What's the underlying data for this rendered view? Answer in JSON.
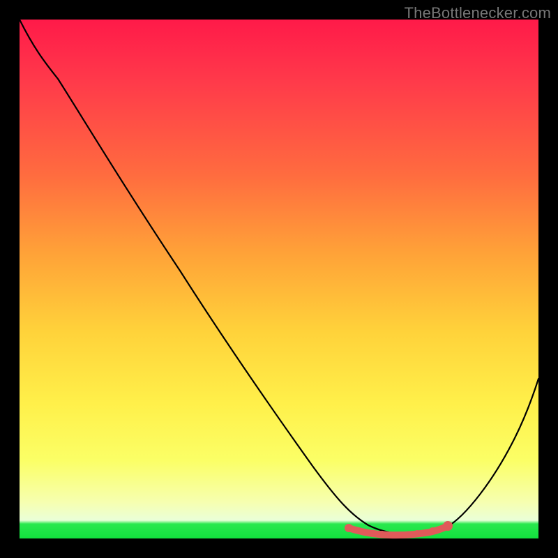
{
  "watermark": "TheBottlenecker.com",
  "colors": {
    "background": "#000000",
    "gradient_top": "#ff1a49",
    "gradient_mid1": "#ff6c3f",
    "gradient_mid2": "#ffd23a",
    "gradient_mid3": "#fbff66",
    "gradient_bottom": "#12e03e",
    "curve": "#000000",
    "markers": "#e05a5a"
  },
  "chart_data": {
    "type": "line",
    "title": "",
    "xlabel": "",
    "ylabel": "",
    "xlim": [
      0,
      100
    ],
    "ylim": [
      0,
      100
    ],
    "x": [
      0,
      3,
      8,
      15,
      25,
      35,
      45,
      55,
      62,
      66,
      70,
      74,
      78,
      82,
      86,
      90,
      95,
      100
    ],
    "values": [
      100,
      95,
      90,
      82,
      68,
      54,
      40,
      25,
      14,
      7,
      3,
      1,
      1,
      2,
      6,
      12,
      22,
      34
    ],
    "annotations": {
      "optimum_band_x": [
        62,
        82
      ],
      "optimum_band_y": 1,
      "marker_points_x": [
        62,
        65,
        68,
        71,
        74,
        77,
        80,
        82
      ]
    },
    "grid": false,
    "legend": false
  }
}
